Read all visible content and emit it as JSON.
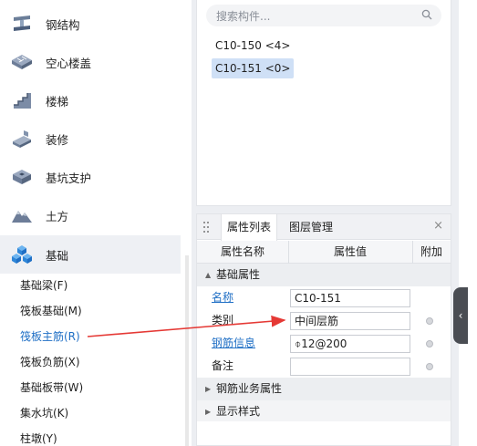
{
  "tree": {
    "categories": [
      {
        "label": "钢结构",
        "icon": "steel-structure-icon"
      },
      {
        "label": "空心楼盖",
        "icon": "hollow-floor-icon"
      },
      {
        "label": "楼梯",
        "icon": "stairs-icon"
      },
      {
        "label": "装修",
        "icon": "decoration-icon"
      },
      {
        "label": "基坑支护",
        "icon": "pit-support-icon"
      },
      {
        "label": "土方",
        "icon": "earthwork-icon"
      },
      {
        "label": "基础",
        "icon": "foundation-icon"
      }
    ],
    "sub_items": [
      "基础梁(F)",
      "筏板基础(M)",
      "筏板主筋(R)",
      "筏板负筋(X)",
      "基础板带(W)",
      "集水坑(K)",
      "柱墩(Y)"
    ]
  },
  "search": {
    "placeholder": "搜索构件..."
  },
  "components": [
    {
      "label": "C10-150 <4>"
    },
    {
      "label": "C10-151 <0>"
    }
  ],
  "properties": {
    "tabs": [
      "属性列表",
      "图层管理"
    ],
    "close": "×",
    "headers": {
      "name": "属性名称",
      "value": "属性值",
      "extra": "附加"
    },
    "groups": [
      "基础属性",
      "钢筋业务属性",
      "显示样式"
    ],
    "rows": [
      {
        "name": "名称",
        "value": "C10-151"
      },
      {
        "name": "类别",
        "value": "中间层筋"
      },
      {
        "name": "钢筋信息",
        "value": "⌽12@200"
      },
      {
        "name": "备注",
        "value": ""
      }
    ]
  },
  "edge_handle": "‹",
  "colors": {
    "accent_blue": "#1f6fc5",
    "selection": "#cfe0f6",
    "arrow_red": "#e53935"
  }
}
